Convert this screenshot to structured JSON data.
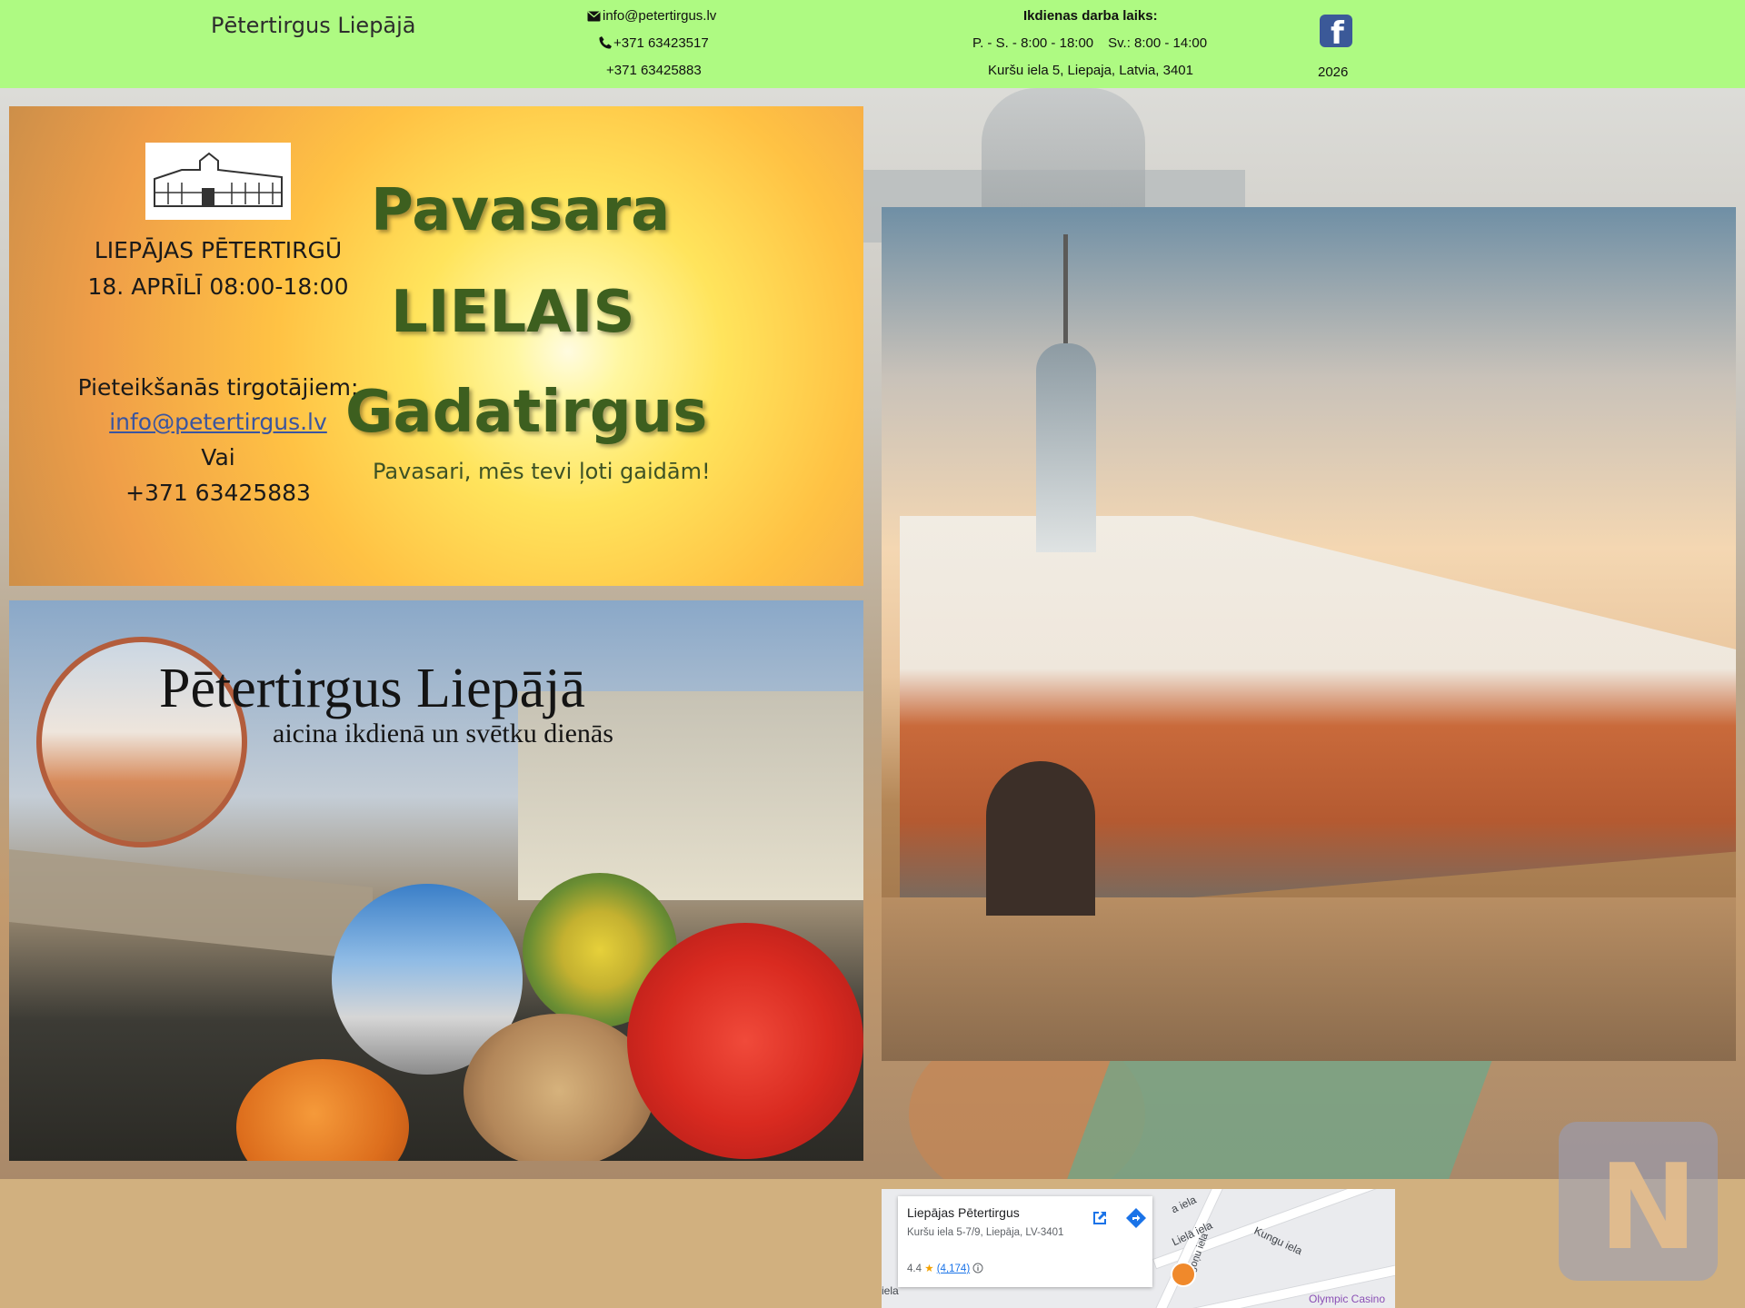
{
  "header": {
    "site_title": "Pētertirgus Liepājā",
    "email": "info@petertirgus.lv",
    "phone_1": "+371 63423517",
    "phone_2": "+371 63425883",
    "hours_title": "Ikdienas darba laiks:",
    "hours_weekdays": "P. - S. - 8:00 - 18:00",
    "hours_sunday": "Sv.: 8:00 - 14:00",
    "address": "Kuršu iela 5, Liepaja, Latvia, 3401",
    "facebook_icon": "facebook-icon",
    "year": "2026"
  },
  "flyer_pavasara": {
    "market_name": "LIEPĀJAS PĒTERTIRGŪ",
    "date": "18. APRĪLĪ 08:00-18:00",
    "apply_text": "Pieteikšanās tirgotājiem:",
    "email": "info@petertirgus.lv",
    "or_text": "Vai",
    "phone": "+371 63425883",
    "word_1": "Pavasara",
    "word_2": "LIELAIS",
    "word_3": "Gadatirgus",
    "tagline": "Pavasari, mēs tevi ļoti gaidām!"
  },
  "flyer_market": {
    "heading": "Pētertirgus Liepājā",
    "subheading": "aicina ikdienā un svētku dienās"
  },
  "map": {
    "place_name": "Liepājas Pētertirgus",
    "address": "Kuršu iela 5-7/9, Liepāja, LV-3401",
    "rating": "4.4",
    "reviews": "(4,174)",
    "street_labels": [
      "a iela",
      "Lielā iela",
      "Kungu iela",
      "Tirgoņu iela",
      "iela"
    ],
    "poi_label": "Olympic Casino"
  },
  "colors": {
    "header_bg": "#aefa82",
    "page_bg": "#d1b07f",
    "facebook": "#3b5998",
    "flyer_title_green": "#3d5f1f"
  }
}
